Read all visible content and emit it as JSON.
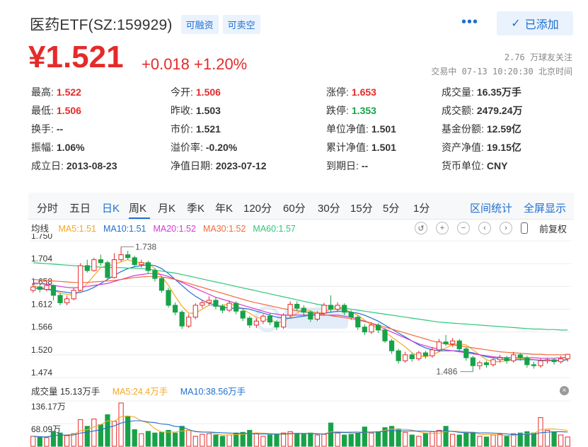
{
  "header": {
    "name": "医药ETF(SZ:159929)",
    "tags": [
      "可融资",
      "可卖空"
    ],
    "more": "•••",
    "added_label": "已添加",
    "added_check": "✓"
  },
  "price": {
    "current": "¥1.521",
    "change": "+0.018 +1.20%",
    "followers": "2.76 万球友关注",
    "status_time": "交易中 07-13 10:20:30 北京时间"
  },
  "quote": [
    [
      {
        "label": "最高:",
        "value": "1.522",
        "tone": "red"
      },
      {
        "label": "今开:",
        "value": "1.506",
        "tone": "red"
      },
      {
        "label": "涨停:",
        "value": "1.653",
        "tone": "red"
      },
      {
        "label": "成交量:",
        "value": "16.35万手",
        "tone": ""
      }
    ],
    [
      {
        "label": "最低:",
        "value": "1.506",
        "tone": "red"
      },
      {
        "label": "昨收:",
        "value": "1.503",
        "tone": ""
      },
      {
        "label": "跌停:",
        "value": "1.353",
        "tone": "green"
      },
      {
        "label": "成交额:",
        "value": "2479.24万",
        "tone": ""
      }
    ],
    [
      {
        "label": "换手:",
        "value": "--",
        "tone": ""
      },
      {
        "label": "市价:",
        "value": "1.521",
        "tone": ""
      },
      {
        "label": "单位净值:",
        "value": "1.501",
        "tone": ""
      },
      {
        "label": "基金份额:",
        "value": "12.59亿",
        "tone": ""
      }
    ],
    [
      {
        "label": "振幅:",
        "value": "1.06%",
        "tone": ""
      },
      {
        "label": "溢价率:",
        "value": "-0.20%",
        "tone": ""
      },
      {
        "label": "累计净值:",
        "value": "1.501",
        "tone": ""
      },
      {
        "label": "资产净值:",
        "value": "19.15亿",
        "tone": ""
      }
    ],
    [
      {
        "label": "成立日:",
        "value": "2013-08-23",
        "tone": ""
      },
      {
        "label": "净值日期:",
        "value": "2023-07-12",
        "tone": ""
      },
      {
        "label": "到期日:",
        "value": "--",
        "tone": ""
      },
      {
        "label": "货币单位:",
        "value": "CNY",
        "tone": ""
      }
    ]
  ],
  "tabs": {
    "items": [
      "分时",
      "五日",
      "日K",
      "周K",
      "月K",
      "季K",
      "年K",
      "120分",
      "60分",
      "30分",
      "15分",
      "5分",
      "1分"
    ],
    "active": 2,
    "range_stats": "区间统计",
    "fullscreen": "全屏显示"
  },
  "ma": {
    "title": "均线",
    "items": [
      {
        "text": "MA5:1.51",
        "color": "#f5a623"
      },
      {
        "text": "MA10:1.51",
        "color": "#1f6fd0"
      },
      {
        "text": "MA20:1.52",
        "color": "#d63ad6"
      },
      {
        "text": "MA30:1.52",
        "color": "#f26b3a"
      },
      {
        "text": "MA60:1.57",
        "color": "#2ec77a"
      }
    ],
    "fuquan": "前复权"
  },
  "colors": {
    "up": "#e52a2a",
    "down": "#18a248",
    "accent": "#1f6fd0"
  },
  "chart_data": {
    "type": "candlestick",
    "y_ticks": [
      "1.750",
      "1.704",
      "1.658",
      "1.612",
      "1.566",
      "1.520",
      "1.474"
    ],
    "ylim": [
      1.474,
      1.75
    ],
    "high_label": "1.738",
    "low_label": "1.486",
    "candles": [
      [
        1.65,
        1.657,
        1.665,
        1.645
      ],
      [
        1.657,
        1.652,
        1.664,
        1.646
      ],
      [
        1.652,
        1.66,
        1.666,
        1.648
      ],
      [
        1.66,
        1.64,
        1.662,
        1.63
      ],
      [
        1.64,
        1.625,
        1.645,
        1.62
      ],
      [
        1.625,
        1.633,
        1.64,
        1.62
      ],
      [
        1.633,
        1.65,
        1.655,
        1.63
      ],
      [
        1.65,
        1.7,
        1.705,
        1.648
      ],
      [
        1.7,
        1.69,
        1.712,
        1.686
      ],
      [
        1.69,
        1.712,
        1.716,
        1.688
      ],
      [
        1.712,
        1.706,
        1.722,
        1.7
      ],
      [
        1.706,
        1.676,
        1.71,
        1.672
      ],
      [
        1.676,
        1.712,
        1.725,
        1.674
      ],
      [
        1.712,
        1.722,
        1.738,
        1.708
      ],
      [
        1.722,
        1.716,
        1.73,
        1.712
      ],
      [
        1.716,
        1.702,
        1.72,
        1.698
      ],
      [
        1.702,
        1.706,
        1.712,
        1.696
      ],
      [
        1.706,
        1.69,
        1.71,
        1.684
      ],
      [
        1.69,
        1.674,
        1.694,
        1.668
      ],
      [
        1.674,
        1.65,
        1.678,
        1.645
      ],
      [
        1.65,
        1.62,
        1.655,
        1.615
      ],
      [
        1.62,
        1.606,
        1.626,
        1.6
      ],
      [
        1.606,
        1.578,
        1.61,
        1.572
      ],
      [
        1.578,
        1.596,
        1.602,
        1.574
      ],
      [
        1.596,
        1.62,
        1.624,
        1.592
      ],
      [
        1.62,
        1.625,
        1.63,
        1.614
      ],
      [
        1.625,
        1.63,
        1.638,
        1.62
      ],
      [
        1.63,
        1.618,
        1.636,
        1.612
      ],
      [
        1.618,
        1.61,
        1.622,
        1.604
      ],
      [
        1.61,
        1.624,
        1.63,
        1.606
      ],
      [
        1.624,
        1.608,
        1.628,
        1.602
      ],
      [
        1.608,
        1.594,
        1.612,
        1.588
      ],
      [
        1.594,
        1.58,
        1.598,
        1.574
      ],
      [
        1.58,
        1.588,
        1.594,
        1.574
      ],
      [
        1.588,
        1.598,
        1.602,
        1.582
      ],
      [
        1.598,
        1.586,
        1.604,
        1.58
      ],
      [
        1.586,
        1.576,
        1.59,
        1.57
      ],
      [
        1.576,
        1.6,
        1.604,
        1.572
      ],
      [
        1.6,
        1.622,
        1.628,
        1.596
      ],
      [
        1.622,
        1.614,
        1.628,
        1.608
      ],
      [
        1.614,
        1.606,
        1.62,
        1.6
      ],
      [
        1.606,
        1.592,
        1.61,
        1.586
      ],
      [
        1.592,
        1.604,
        1.608,
        1.588
      ],
      [
        1.604,
        1.62,
        1.625,
        1.6
      ],
      [
        1.62,
        1.612,
        1.64,
        1.606
      ],
      [
        1.612,
        1.62,
        1.626,
        1.606
      ],
      [
        1.62,
        1.606,
        1.624,
        1.6
      ],
      [
        1.606,
        1.596,
        1.61,
        1.59
      ],
      [
        1.596,
        1.576,
        1.6,
        1.57
      ],
      [
        1.576,
        1.566,
        1.582,
        1.56
      ],
      [
        1.566,
        1.58,
        1.586,
        1.562
      ],
      [
        1.58,
        1.57,
        1.584,
        1.564
      ],
      [
        1.57,
        1.548,
        1.574,
        1.544
      ],
      [
        1.548,
        1.528,
        1.552,
        1.522
      ],
      [
        1.528,
        1.508,
        1.532,
        1.502
      ],
      [
        1.508,
        1.52,
        1.526,
        1.504
      ],
      [
        1.52,
        1.512,
        1.524,
        1.506
      ],
      [
        1.512,
        1.524,
        1.528,
        1.508
      ],
      [
        1.524,
        1.518,
        1.528,
        1.512
      ],
      [
        1.518,
        1.53,
        1.536,
        1.514
      ],
      [
        1.53,
        1.546,
        1.552,
        1.526
      ],
      [
        1.546,
        1.542,
        1.56,
        1.538
      ],
      [
        1.542,
        1.548,
        1.554,
        1.536
      ],
      [
        1.548,
        1.532,
        1.552,
        1.526
      ],
      [
        1.532,
        1.514,
        1.536,
        1.508
      ],
      [
        1.514,
        1.498,
        1.518,
        1.486
      ],
      [
        1.498,
        1.504,
        1.508,
        1.49
      ],
      [
        1.504,
        1.5,
        1.508,
        1.494
      ],
      [
        1.5,
        1.51,
        1.514,
        1.496
      ],
      [
        1.51,
        1.514,
        1.52,
        1.504
      ],
      [
        1.514,
        1.508,
        1.518,
        1.502
      ],
      [
        1.508,
        1.52,
        1.526,
        1.504
      ],
      [
        1.52,
        1.514,
        1.524,
        1.508
      ],
      [
        1.514,
        1.5,
        1.518,
        1.494
      ],
      [
        1.5,
        1.498,
        1.506,
        1.492
      ],
      [
        1.498,
        1.508,
        1.512,
        1.494
      ],
      [
        1.508,
        1.51,
        1.514,
        1.502
      ],
      [
        1.51,
        1.506,
        1.514,
        1.5
      ],
      [
        1.506,
        1.512,
        1.518,
        1.502
      ],
      [
        1.512,
        1.521,
        1.522,
        1.506
      ]
    ],
    "ma_lines": {
      "MA5": [
        1.66,
        1.656,
        1.654,
        1.65,
        1.645,
        1.642,
        1.64,
        1.65,
        1.664,
        1.68,
        1.696,
        1.7,
        1.702,
        1.708,
        1.712,
        1.708,
        1.706,
        1.704,
        1.694,
        1.678,
        1.66,
        1.638,
        1.618,
        1.604,
        1.604,
        1.612,
        1.62,
        1.618,
        1.62,
        1.622,
        1.62,
        1.612,
        1.604,
        1.596,
        1.592,
        1.59,
        1.586,
        1.586,
        1.596,
        1.604,
        1.612,
        1.608,
        1.604,
        1.606,
        1.612,
        1.614,
        1.612,
        1.606,
        1.6,
        1.59,
        1.58,
        1.574,
        1.566,
        1.556,
        1.546,
        1.536,
        1.524,
        1.518,
        1.516,
        1.52,
        1.526,
        1.534,
        1.54,
        1.542,
        1.54,
        1.53,
        1.52,
        1.51,
        1.506,
        1.506,
        1.508,
        1.51,
        1.512,
        1.512,
        1.51,
        1.508,
        1.508,
        1.508,
        1.508,
        1.51
      ],
      "MA10": [
        1.655,
        1.654,
        1.652,
        1.65,
        1.648,
        1.646,
        1.644,
        1.646,
        1.65,
        1.656,
        1.664,
        1.672,
        1.68,
        1.688,
        1.694,
        1.698,
        1.7,
        1.702,
        1.7,
        1.694,
        1.684,
        1.672,
        1.66,
        1.648,
        1.638,
        1.63,
        1.624,
        1.62,
        1.616,
        1.614,
        1.614,
        1.614,
        1.612,
        1.608,
        1.604,
        1.6,
        1.596,
        1.594,
        1.594,
        1.596,
        1.598,
        1.6,
        1.602,
        1.604,
        1.606,
        1.608,
        1.608,
        1.606,
        1.604,
        1.6,
        1.594,
        1.588,
        1.58,
        1.572,
        1.564,
        1.556,
        1.548,
        1.54,
        1.534,
        1.53,
        1.528,
        1.528,
        1.528,
        1.528,
        1.526,
        1.524,
        1.52,
        1.516,
        1.514,
        1.512,
        1.51,
        1.51,
        1.51,
        1.51,
        1.51,
        1.509,
        1.509,
        1.509,
        1.509,
        1.51
      ],
      "MA20": [
        1.665,
        1.664,
        1.662,
        1.66,
        1.658,
        1.656,
        1.655,
        1.656,
        1.658,
        1.66,
        1.662,
        1.664,
        1.668,
        1.672,
        1.676,
        1.68,
        1.682,
        1.684,
        1.684,
        1.682,
        1.678,
        1.672,
        1.666,
        1.66,
        1.654,
        1.648,
        1.642,
        1.636,
        1.632,
        1.628,
        1.624,
        1.62,
        1.616,
        1.612,
        1.608,
        1.604,
        1.602,
        1.6,
        1.6,
        1.6,
        1.6,
        1.6,
        1.6,
        1.6,
        1.6,
        1.6,
        1.598,
        1.596,
        1.592,
        1.588,
        1.584,
        1.578,
        1.572,
        1.566,
        1.56,
        1.554,
        1.548,
        1.542,
        1.538,
        1.534,
        1.532,
        1.53,
        1.528,
        1.526,
        1.524,
        1.522,
        1.52,
        1.518,
        1.516,
        1.515,
        1.514,
        1.514,
        1.514,
        1.514,
        1.514,
        1.513,
        1.513,
        1.513,
        1.514,
        1.515
      ],
      "MA30": [
        1.672,
        1.671,
        1.67,
        1.669,
        1.668,
        1.667,
        1.666,
        1.666,
        1.666,
        1.667,
        1.668,
        1.669,
        1.67,
        1.672,
        1.674,
        1.676,
        1.677,
        1.678,
        1.678,
        1.677,
        1.675,
        1.672,
        1.668,
        1.664,
        1.66,
        1.656,
        1.652,
        1.648,
        1.644,
        1.64,
        1.636,
        1.632,
        1.628,
        1.625,
        1.622,
        1.619,
        1.616,
        1.613,
        1.611,
        1.609,
        1.607,
        1.605,
        1.603,
        1.601,
        1.599,
        1.597,
        1.595,
        1.593,
        1.59,
        1.587,
        1.584,
        1.58,
        1.576,
        1.572,
        1.568,
        1.564,
        1.56,
        1.556,
        1.552,
        1.548,
        1.545,
        1.542,
        1.54,
        1.538,
        1.536,
        1.534,
        1.532,
        1.53,
        1.528,
        1.526,
        1.525,
        1.524,
        1.523,
        1.522,
        1.521,
        1.521,
        1.52,
        1.52,
        1.52,
        1.52
      ],
      "MA60": [
        1.706,
        1.705,
        1.704,
        1.703,
        1.702,
        1.701,
        1.7,
        1.699,
        1.698,
        1.698,
        1.697,
        1.697,
        1.696,
        1.696,
        1.695,
        1.695,
        1.694,
        1.693,
        1.691,
        1.689,
        1.687,
        1.685,
        1.682,
        1.679,
        1.676,
        1.673,
        1.67,
        1.667,
        1.664,
        1.661,
        1.658,
        1.655,
        1.652,
        1.649,
        1.646,
        1.643,
        1.64,
        1.637,
        1.634,
        1.631,
        1.628,
        1.625,
        1.622,
        1.62,
        1.618,
        1.616,
        1.614,
        1.612,
        1.61,
        1.608,
        1.606,
        1.604,
        1.602,
        1.6,
        1.598,
        1.596,
        1.594,
        1.592,
        1.59,
        1.588,
        1.586,
        1.585,
        1.584,
        1.583,
        1.582,
        1.581,
        1.58,
        1.579,
        1.578,
        1.577,
        1.576,
        1.575,
        1.574,
        1.573,
        1.572,
        1.572,
        1.571,
        1.571,
        1.57,
        1.57
      ]
    }
  },
  "volume": {
    "title": "成交量 15.13万手",
    "ma5": "MA5:24.4万手",
    "ma10": "MA10:38.56万手",
    "y_ticks": [
      "136.17万",
      "68.09万"
    ],
    "ymax": 136.17,
    "values": [
      30,
      28,
      26,
      45,
      40,
      32,
      38,
      80,
      60,
      82,
      65,
      95,
      75,
      130,
      90,
      50,
      38,
      45,
      40,
      42,
      48,
      40,
      60,
      48,
      30,
      36,
      38,
      34,
      30,
      34,
      40,
      42,
      48,
      38,
      30,
      34,
      36,
      40,
      44,
      38,
      36,
      40,
      34,
      36,
      70,
      40,
      34,
      36,
      40,
      58,
      40,
      44,
      56,
      60,
      52,
      42,
      34,
      30,
      40,
      44,
      48,
      60,
      36,
      34,
      40,
      42,
      30,
      28,
      34,
      36,
      30,
      38,
      40,
      44,
      40,
      86,
      48,
      42,
      34,
      28
    ],
    "close": "×"
  }
}
